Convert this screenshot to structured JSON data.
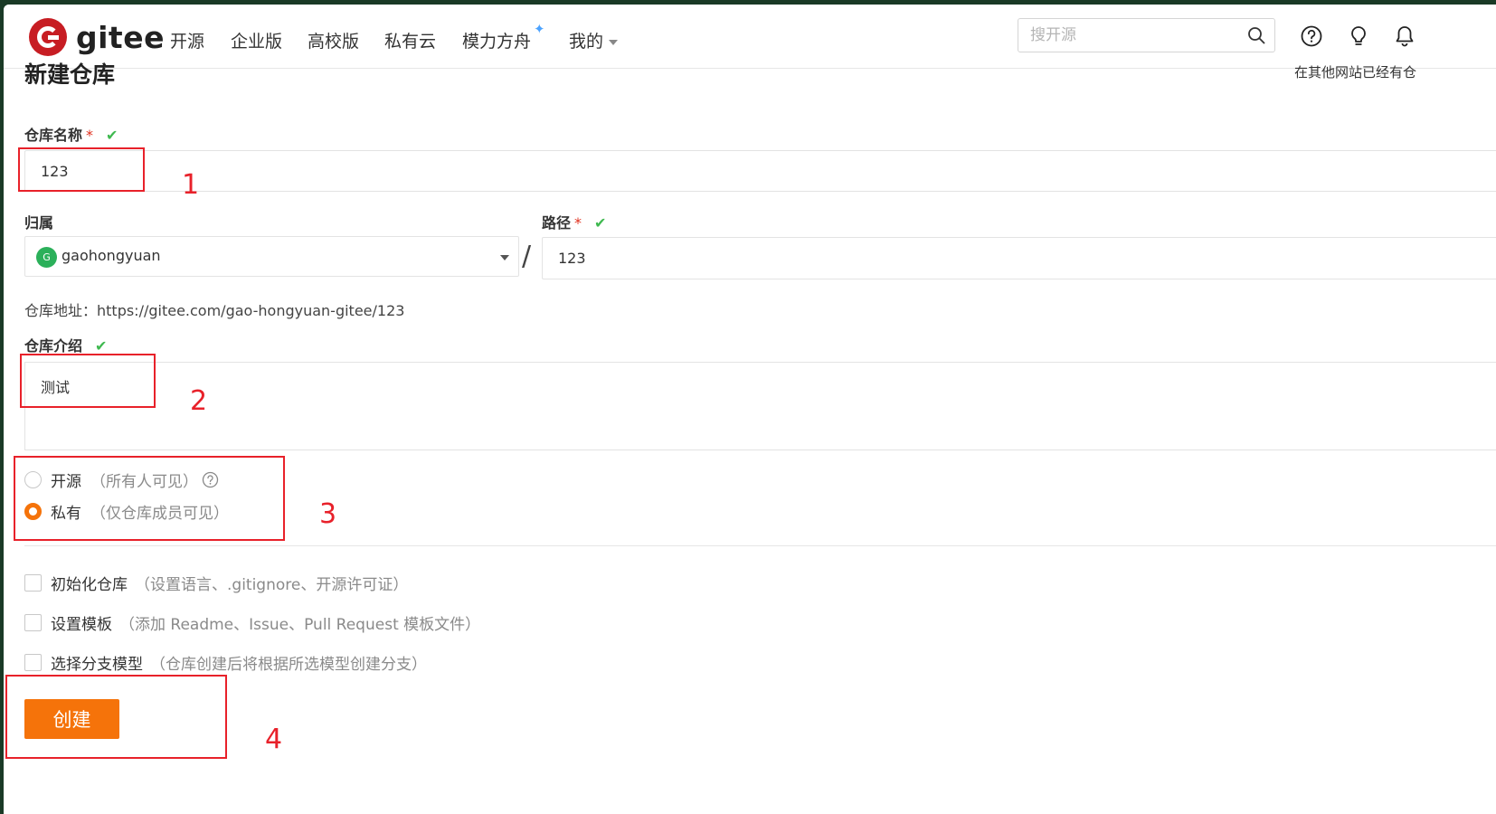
{
  "header": {
    "logo_text": "gitee",
    "nav": [
      {
        "label": "开源"
      },
      {
        "label": "企业版"
      },
      {
        "label": "高校版"
      },
      {
        "label": "私有云"
      },
      {
        "label": "模力方舟"
      },
      {
        "label": "我的"
      }
    ],
    "search": {
      "placeholder": "搜开源",
      "value": ""
    }
  },
  "page": {
    "title": "新建仓库",
    "import_hint": "在其他网站已经有仓"
  },
  "form": {
    "repo_name": {
      "label": "仓库名称",
      "required_mark": "*",
      "value": "123"
    },
    "owner": {
      "label": "归属",
      "avatar_letter": "G",
      "value": "gaohongyuan"
    },
    "separator": "/",
    "path": {
      "label": "路径",
      "required_mark": "*",
      "value": "123"
    },
    "repo_url": "仓库地址：https://gitee.com/gao-hongyuan-gitee/123",
    "description": {
      "label": "仓库介绍",
      "value": "测试"
    },
    "visibility": [
      {
        "label": "开源",
        "hint": "（所有人可见）",
        "selected": false
      },
      {
        "label": "私有",
        "hint": "（仅仓库成员可见）",
        "selected": true
      }
    ],
    "options": [
      {
        "label": "初始化仓库",
        "hint": "（设置语言、.gitignore、开源许可证）",
        "checked": false
      },
      {
        "label": "设置模板",
        "hint": "（添加 Readme、Issue、Pull Request 模板文件）",
        "checked": false
      },
      {
        "label": "选择分支模型",
        "hint": "（仓库创建后将根据所选模型创建分支）",
        "checked": false
      }
    ],
    "submit_label": "创建"
  },
  "annotations": [
    "1",
    "2",
    "3",
    "4"
  ],
  "colors": {
    "accent": "#f5730a",
    "annotation": "#e8212a",
    "valid": "#3fb950",
    "brand": "#c71d23"
  }
}
